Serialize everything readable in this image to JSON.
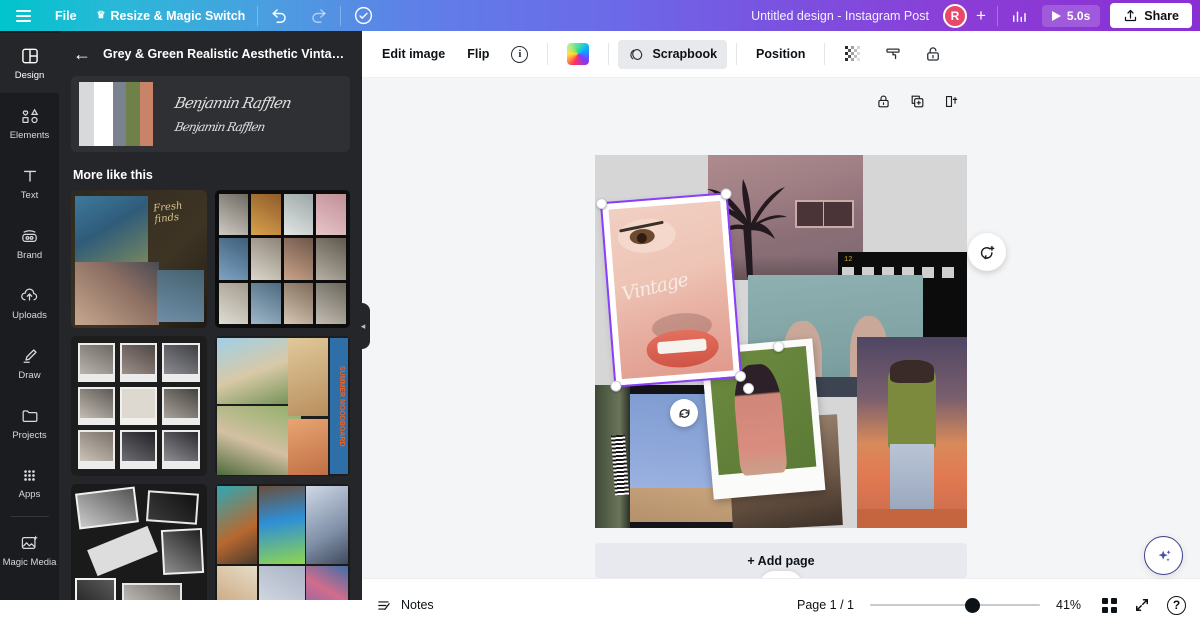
{
  "topbar": {
    "menu_icon": "hamburger-icon",
    "file_label": "File",
    "resize_label": "Resize & Magic Switch",
    "crown_glyph": "♛",
    "undo_icon": "undo-icon",
    "redo_icon": "redo-icon",
    "cloud_icon": "cloud-saved-icon",
    "doc_title": "Untitled design - Instagram Post",
    "avatar_initial": "R",
    "add_collaborator_label": "+",
    "analytics_icon": "bar-chart-icon",
    "duration_label": "5.0s",
    "play_icon": "play-icon",
    "share_label": "Share",
    "share_icon": "share-upload-icon",
    "colors": {
      "gradient_start": "#00c4cc",
      "gradient_mid": "#6b6be8",
      "gradient_end": "#8b2fd4",
      "avatar_bg": "#e8496b"
    }
  },
  "rail": {
    "items": [
      {
        "label": "Design",
        "icon": "design-icon",
        "active": true
      },
      {
        "label": "Elements",
        "icon": "elements-icon",
        "active": false
      },
      {
        "label": "Text",
        "icon": "text-icon",
        "active": false
      },
      {
        "label": "Brand",
        "icon": "brand-icon",
        "active": false
      },
      {
        "label": "Uploads",
        "icon": "uploads-icon",
        "active": false
      },
      {
        "label": "Draw",
        "icon": "draw-icon",
        "active": false
      },
      {
        "label": "Projects",
        "icon": "projects-icon",
        "active": false
      },
      {
        "label": "Apps",
        "icon": "apps-icon",
        "active": false
      },
      {
        "label": "Magic Media",
        "icon": "magic-media-icon",
        "active": false
      }
    ]
  },
  "panel": {
    "back_icon": "back-arrow-icon",
    "title": "Grey & Green Realistic Aesthetic Vintage ...",
    "collapse_icon": "chevron-left-icon",
    "template_swatches": [
      "#d7d9da",
      "#ffffff",
      "#7a8290",
      "#6f8049",
      "#c98368"
    ],
    "signature_lines": [
      "Benjamin  Rafflen",
      "Benjamin  Rafflen"
    ],
    "more_like_this_label": "More like this",
    "thumbs": [
      {
        "name": "thumb-fresh-finds-collage"
      },
      {
        "name": "thumb-filmstrip-grid"
      },
      {
        "name": "thumb-polaroid-wall"
      },
      {
        "name": "thumb-summer-moodboard"
      },
      {
        "name": "thumb-bw-scrapbook"
      },
      {
        "name": "thumb-thrift-haul-collage"
      }
    ]
  },
  "toolbar": {
    "edit_image_label": "Edit image",
    "flip_label": "Flip",
    "info_icon": "info-icon",
    "color_icon": "rainbow-color-icon",
    "scrapbook_label": "Scrapbook",
    "scrapbook_icon": "scrapbook-icon",
    "position_label": "Position",
    "transparency_icon": "transparency-icon",
    "copy_style_icon": "copy-style-icon",
    "lock_icon": "lock-open-icon"
  },
  "canvas": {
    "float_icons": [
      "lock-icon",
      "duplicate-page-icon",
      "expand-page-icon"
    ],
    "comment_icon": "add-comment-icon",
    "rotate_icon": "rotate-handle-icon",
    "add_page_label": "+ Add page",
    "scroll_up_icon": "chevron-up-icon",
    "selection_color": "#8b3dff",
    "vintage_script_text": "Vintage",
    "film_number": "12"
  },
  "statusbar": {
    "notes_label": "Notes",
    "notes_icon": "notes-icon",
    "page_label": "Page 1 / 1",
    "zoom_value": "41%",
    "grid_view_icon": "grid-view-icon",
    "fullscreen_icon": "fullscreen-icon",
    "help_icon": "help-icon",
    "magic_icon": "magic-sparkle-icon"
  }
}
